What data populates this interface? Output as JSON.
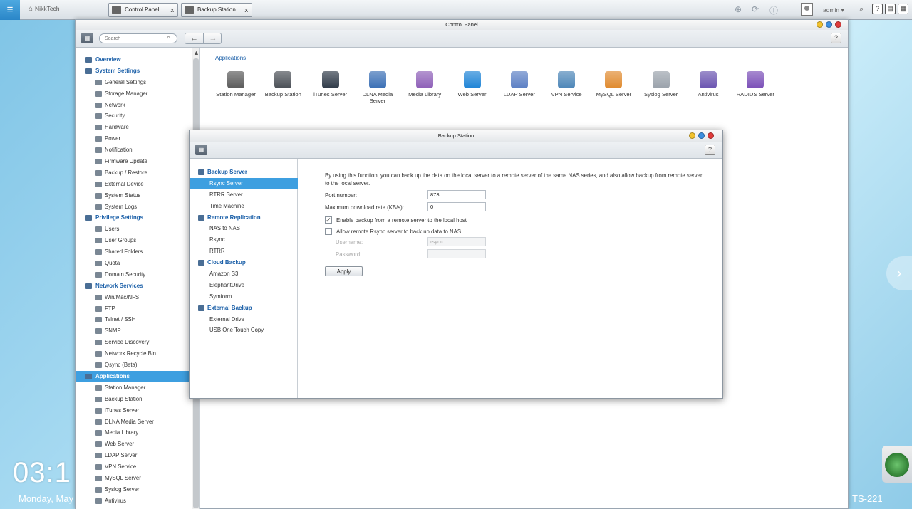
{
  "taskbar": {
    "home_label": "NikkTech",
    "tabs": [
      {
        "label": "Control Panel",
        "close": "x"
      },
      {
        "label": "Backup Station",
        "close": "x"
      }
    ],
    "user": "admin",
    "help_label": "?"
  },
  "desktop": {
    "clock": "03:1",
    "date": "Monday, May",
    "model": "TS-221"
  },
  "control_panel": {
    "title": "Control Panel",
    "search_placeholder": "Search",
    "help_label": "?",
    "sidebar": [
      {
        "type": "cat",
        "label": "Overview"
      },
      {
        "type": "cat",
        "label": "System Settings"
      },
      {
        "type": "item",
        "label": "General Settings"
      },
      {
        "type": "item",
        "label": "Storage Manager"
      },
      {
        "type": "item",
        "label": "Network"
      },
      {
        "type": "item",
        "label": "Security"
      },
      {
        "type": "item",
        "label": "Hardware"
      },
      {
        "type": "item",
        "label": "Power"
      },
      {
        "type": "item",
        "label": "Notification"
      },
      {
        "type": "item",
        "label": "Firmware Update"
      },
      {
        "type": "item",
        "label": "Backup / Restore"
      },
      {
        "type": "item",
        "label": "External Device"
      },
      {
        "type": "item",
        "label": "System Status"
      },
      {
        "type": "item",
        "label": "System Logs"
      },
      {
        "type": "cat",
        "label": "Privilege Settings"
      },
      {
        "type": "item",
        "label": "Users"
      },
      {
        "type": "item",
        "label": "User Groups"
      },
      {
        "type": "item",
        "label": "Shared Folders"
      },
      {
        "type": "item",
        "label": "Quota"
      },
      {
        "type": "item",
        "label": "Domain Security"
      },
      {
        "type": "cat",
        "label": "Network Services"
      },
      {
        "type": "item",
        "label": "Win/Mac/NFS"
      },
      {
        "type": "item",
        "label": "FTP"
      },
      {
        "type": "item",
        "label": "Telnet / SSH"
      },
      {
        "type": "item",
        "label": "SNMP"
      },
      {
        "type": "item",
        "label": "Service Discovery"
      },
      {
        "type": "item",
        "label": "Network Recycle Bin"
      },
      {
        "type": "item",
        "label": "Qsync (Beta)"
      },
      {
        "type": "cat",
        "label": "Applications",
        "active": true
      },
      {
        "type": "item",
        "label": "Station Manager"
      },
      {
        "type": "item",
        "label": "Backup Station"
      },
      {
        "type": "item",
        "label": "iTunes Server"
      },
      {
        "type": "item",
        "label": "DLNA Media Server"
      },
      {
        "type": "item",
        "label": "Media Library"
      },
      {
        "type": "item",
        "label": "Web Server"
      },
      {
        "type": "item",
        "label": "LDAP Server"
      },
      {
        "type": "item",
        "label": "VPN Service"
      },
      {
        "type": "item",
        "label": "MySQL Server"
      },
      {
        "type": "item",
        "label": "Syslog Server"
      },
      {
        "type": "item",
        "label": "Antivirus"
      }
    ],
    "apps_heading": "Applications",
    "apps": [
      {
        "label": "Station Manager",
        "color": "#5a5a5a"
      },
      {
        "label": "Backup Station",
        "color": "#4a4f56"
      },
      {
        "label": "iTunes Server",
        "color": "#2f3a48"
      },
      {
        "label": "DLNA Media Server",
        "color": "#3a6fb5"
      },
      {
        "label": "Media Library",
        "color": "#8e5fb8"
      },
      {
        "label": "Web Server",
        "color": "#1e84d6"
      },
      {
        "label": "LDAP Server",
        "color": "#5b7fc4"
      },
      {
        "label": "VPN Service",
        "color": "#4d86b8"
      },
      {
        "label": "MySQL Server",
        "color": "#e08a2e"
      },
      {
        "label": "Syslog Server",
        "color": "#9aa2ab"
      },
      {
        "label": "Antivirus",
        "color": "#6a54b0"
      },
      {
        "label": "RADIUS Server",
        "color": "#7b4fb8"
      }
    ]
  },
  "backup_station": {
    "title": "Backup Station",
    "help_label": "?",
    "nav": [
      {
        "type": "cat",
        "label": "Backup Server"
      },
      {
        "type": "item",
        "label": "Rsync Server",
        "active": true
      },
      {
        "type": "item",
        "label": "RTRR Server"
      },
      {
        "type": "item",
        "label": "Time Machine"
      },
      {
        "type": "cat",
        "label": "Remote Replication"
      },
      {
        "type": "item",
        "label": "NAS to NAS"
      },
      {
        "type": "item",
        "label": "Rsync"
      },
      {
        "type": "item",
        "label": "RTRR"
      },
      {
        "type": "cat",
        "label": "Cloud Backup"
      },
      {
        "type": "item",
        "label": "Amazon S3"
      },
      {
        "type": "item",
        "label": "ElephantDrive"
      },
      {
        "type": "item",
        "label": "Symform"
      },
      {
        "type": "cat",
        "label": "External Backup"
      },
      {
        "type": "item",
        "label": "External Drive"
      },
      {
        "type": "item",
        "label": "USB One Touch Copy"
      }
    ],
    "description": "By using this function, you can back up the data on the local server to a remote server of the same NAS series, and also allow backup from remote server to the local server.",
    "port_label": "Port number:",
    "port_value": "873",
    "max_rate_label": "Maximum download rate (KB/s):",
    "max_rate_value": "0",
    "enable_label": "Enable backup from a remote server to the local host",
    "allow_label": "Allow remote Rsync server to back up data to NAS",
    "username_label": "Username:",
    "username_value": "rsync",
    "password_label": "Password:",
    "password_value": "",
    "apply_label": "Apply"
  },
  "colors": {
    "accent": "#3e9fe0",
    "category_text": "#1a5fa8"
  }
}
